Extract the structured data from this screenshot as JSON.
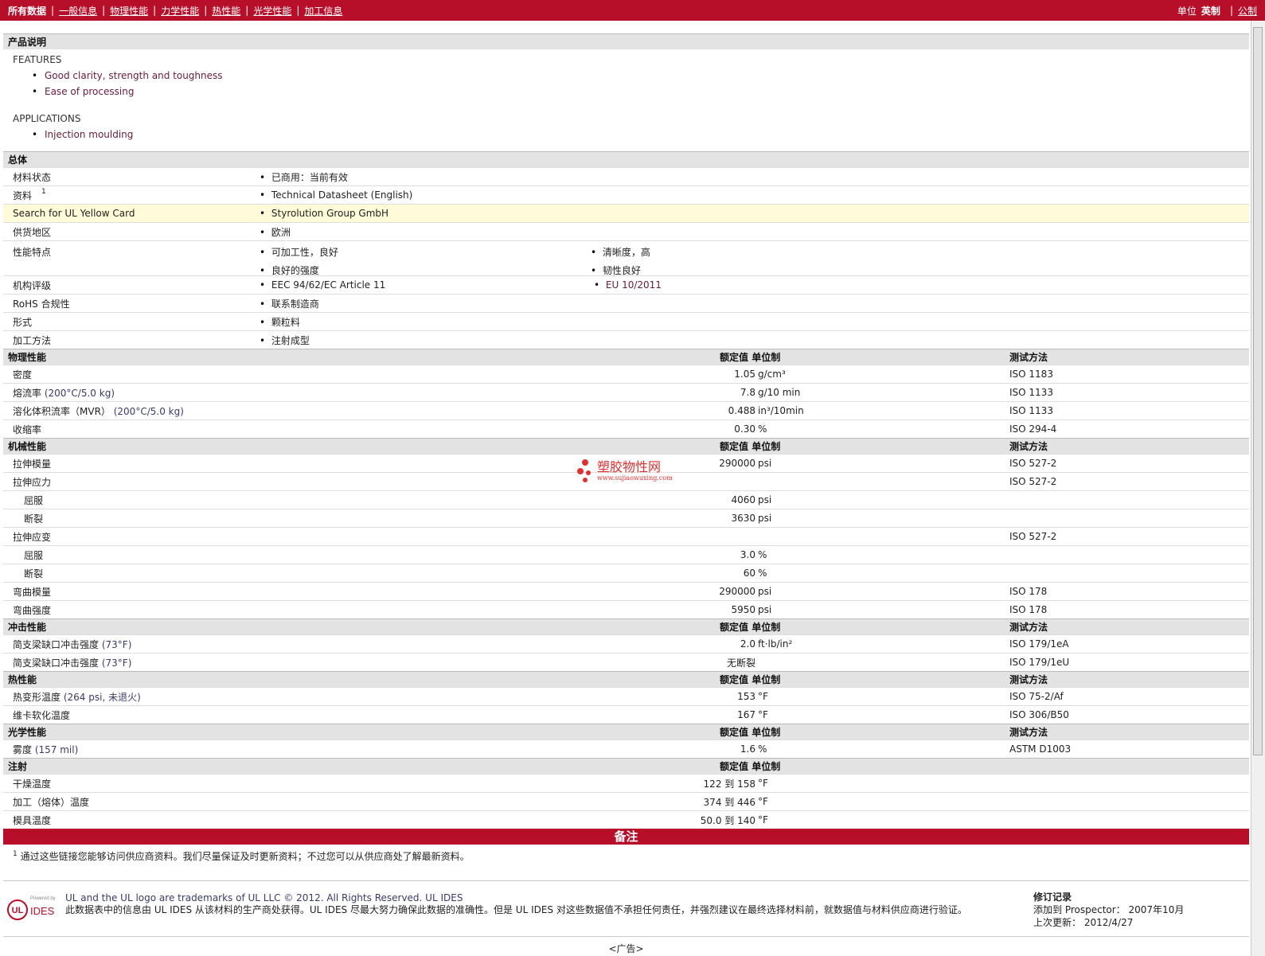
{
  "nav": {
    "items": [
      "所有数据",
      "一般信息",
      "物理性能",
      "力学性能",
      "热性能",
      "光学性能",
      "加工信息"
    ],
    "units_label": "单位",
    "unit_active": "英制",
    "unit_other": "公制"
  },
  "desc": {
    "title": "产品说明",
    "features_cap": "FEATURES",
    "features": [
      "Good clarity, strength and toughness",
      "Ease of processing"
    ],
    "apps_cap": "APPLICATIONS",
    "apps": [
      "Injection moulding"
    ]
  },
  "general": {
    "title": "总体",
    "rows": [
      {
        "label": "材料状态",
        "values": [
          "已商用：当前有效"
        ]
      },
      {
        "label": "资料",
        "sup": "1",
        "values": [
          "Technical Datasheet (English)"
        ]
      },
      {
        "label": "Search for UL Yellow Card",
        "values": [
          "Styrolution Group GmbH"
        ]
      },
      {
        "label": "供货地区",
        "values": [
          "欧洲"
        ]
      },
      {
        "label": "性能特点",
        "col1": [
          "可加工性，良好",
          "良好的强度"
        ],
        "col2": [
          "清晰度，高",
          "韧性良好"
        ]
      },
      {
        "label": "机构评级",
        "values": [
          "EEC 94/62/EC Article 11"
        ],
        "values2": [
          "EU 10/2011"
        ]
      },
      {
        "label": "RoHS 合规性",
        "values": [
          "联系制造商"
        ]
      },
      {
        "label": "形式",
        "values": [
          "颗粒料"
        ]
      },
      {
        "label": "加工方法",
        "values": [
          "注射成型"
        ]
      }
    ]
  },
  "headers": {
    "nominal": "额定值",
    "unit": "单位制",
    "method": "测试方法"
  },
  "physical": {
    "title": "物理性能",
    "rows": [
      {
        "label": "密度",
        "cond": "",
        "value": "1.05",
        "unit": "g/cm³",
        "method": "ISO 1183"
      },
      {
        "label": "熔流率",
        "cond": "(200°C/5.0 kg)",
        "value": "7.8",
        "unit": "g/10 min",
        "method": "ISO 1133"
      },
      {
        "label": "溶化体积流率（MVR）",
        "cond": "(200°C/5.0 kg)",
        "value": "0.488",
        "unit": "in³/10min",
        "method": "ISO 1133"
      },
      {
        "label": "收缩率",
        "cond": "",
        "value": "0.30",
        "unit": "%",
        "method": "ISO 294-4"
      }
    ]
  },
  "mechanical": {
    "title": "机械性能",
    "rows": [
      {
        "label": "拉伸模量",
        "value": "290000",
        "unit": "psi",
        "method": "ISO 527-2"
      },
      {
        "label": "拉伸应力",
        "value": "",
        "unit": "",
        "method": "ISO 527-2"
      },
      {
        "label": "屈服",
        "value": "4060",
        "unit": "psi",
        "method": "",
        "sub": true
      },
      {
        "label": "断裂",
        "value": "3630",
        "unit": "psi",
        "method": "",
        "sub": true
      },
      {
        "label": "拉伸应变",
        "value": "",
        "unit": "",
        "method": "ISO 527-2"
      },
      {
        "label": "屈服",
        "value": "3.0",
        "unit": "%",
        "method": "",
        "sub": true
      },
      {
        "label": "断裂",
        "value": "60",
        "unit": "%",
        "method": "",
        "sub": true
      },
      {
        "label": "弯曲模量",
        "value": "290000",
        "unit": "psi",
        "method": "ISO 178"
      },
      {
        "label": "弯曲强度",
        "value": "5950",
        "unit": "psi",
        "method": "ISO 178"
      }
    ]
  },
  "impact": {
    "title": "冲击性能",
    "rows": [
      {
        "label": "简支梁缺口冲击强度",
        "cond": "(73°F)",
        "value": "2.0",
        "unit": "ft·lb/in²",
        "method": "ISO 179/1eA"
      },
      {
        "label": "简支梁缺口冲击强度",
        "cond": "(73°F)",
        "value": "无断裂",
        "unit": "",
        "method": "ISO 179/1eU"
      }
    ]
  },
  "thermal": {
    "title": "热性能",
    "rows": [
      {
        "label": "热变形温度",
        "cond": "(264 psi, 未退火)",
        "value": "153",
        "unit": "°F",
        "method": "ISO 75-2/Af"
      },
      {
        "label": "维卡软化温度",
        "cond": "",
        "value": "167",
        "unit": "°F",
        "method": "ISO 306/B50"
      }
    ]
  },
  "optical": {
    "title": "光学性能",
    "rows": [
      {
        "label": "雾度",
        "cond": "(157 mil)",
        "value": "1.6",
        "unit": "%",
        "method": "ASTM D1003"
      }
    ]
  },
  "injection": {
    "title": "注射",
    "rows": [
      {
        "label": "干燥温度",
        "value": "122 到 158",
        "unit": "°F"
      },
      {
        "label": "加工（熔体）温度",
        "value": "374 到 446",
        "unit": "°F"
      },
      {
        "label": "模具温度",
        "value": "50.0 到 140",
        "unit": "°F"
      }
    ]
  },
  "watermark": {
    "name": "塑胶物性网",
    "url": "www.sujiaowuxing.com"
  },
  "notes": {
    "title": "备注",
    "sup": "1",
    "text": "通过这些链接您能够访问供应商资料。我们尽量保证及时更新资料；不过您可以从供应商处了解最新资料。"
  },
  "footer": {
    "powered": "Powered by",
    "ul": "UL",
    "ides": "IDES",
    "line1": "UL and the UL logo are trademarks of UL LLC © 2012. All Rights Reserved. UL IDES",
    "line2": "此数据表中的信息由 UL IDES 从该材料的生产商处获得。UL IDES 尽最大努力确保此数据的准确性。但是 UL IDES 对这些数据值不承担任何责任，并强烈建议在最终选择材料前，就数据值与材料供应商进行验证。",
    "rev_title": "修订记录",
    "added_label": "添加到 Prospector：",
    "added": "2007年10月",
    "updated_label": "上次更新：",
    "updated": "2012/4/27",
    "ad": "<广告>"
  }
}
